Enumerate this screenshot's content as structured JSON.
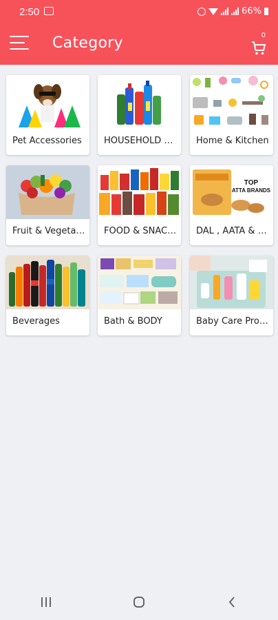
{
  "status_bar": {
    "time": "2:50",
    "battery": "66%"
  },
  "app_bar": {
    "title": "Category",
    "cart_count": "0"
  },
  "categories": [
    {
      "label": "Pet Accessories"
    },
    {
      "label": "HOUSEHOLD NEEDS"
    },
    {
      "label": "Home & Kitchen"
    },
    {
      "label": "Fruit & Vegetables"
    },
    {
      "label": "FOOD & SNACKS"
    },
    {
      "label": "DAL , AATA & MORE"
    },
    {
      "label": "Beverages"
    },
    {
      "label": "Bath & BODY"
    },
    {
      "label": "Baby Care Products"
    }
  ],
  "atta_banner": {
    "line1": "TOP",
    "line2": "ATTA BRANDS"
  },
  "colors": {
    "accent": "#f7515a",
    "background": "#eef0f4"
  }
}
